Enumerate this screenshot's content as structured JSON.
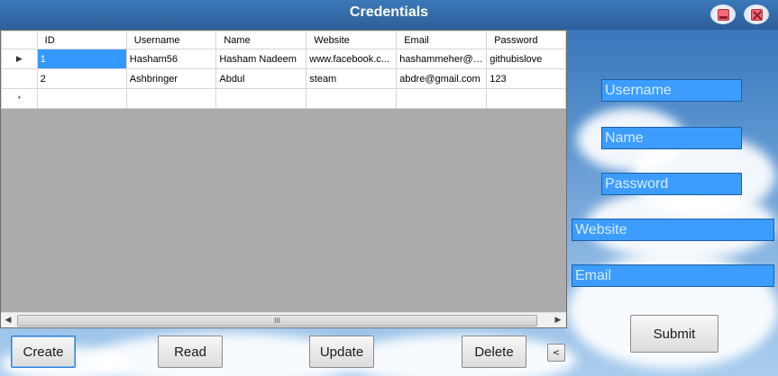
{
  "window": {
    "title": "Credentials",
    "minimize_icon": "minimize-icon",
    "close_icon": "close-icon"
  },
  "grid": {
    "columns": [
      "ID",
      "Username",
      "Name",
      "Website",
      "Email",
      "Password"
    ],
    "rows": [
      {
        "marker": "▶",
        "cells": [
          "1",
          "Hasham56",
          "Hasham Nadeem",
          "www.facebook.c...",
          "hashammeher@g...",
          "githubislove"
        ]
      },
      {
        "marker": "",
        "cells": [
          "2",
          "Ashbringer",
          "Abdul",
          "steam",
          "abdre@gmail.com",
          "123"
        ]
      },
      {
        "marker": "*",
        "cells": [
          "",
          "",
          "",
          "",
          "",
          ""
        ]
      }
    ],
    "scroll_left": "◀",
    "scroll_right": "▶",
    "scroll_thumb": "III"
  },
  "buttons": {
    "create": "Create",
    "read": "Read",
    "update": "Update",
    "delete": "Delete",
    "collapse": "<",
    "submit": "Submit"
  },
  "form": {
    "username_placeholder": "Username",
    "name_placeholder": "Name",
    "password_placeholder": "Password",
    "website_placeholder": "Website",
    "email_placeholder": "Email"
  },
  "colors": {
    "titlebar": "#2c5f9b",
    "field_bg": "#3c9dff",
    "selection": "#3399ff"
  }
}
